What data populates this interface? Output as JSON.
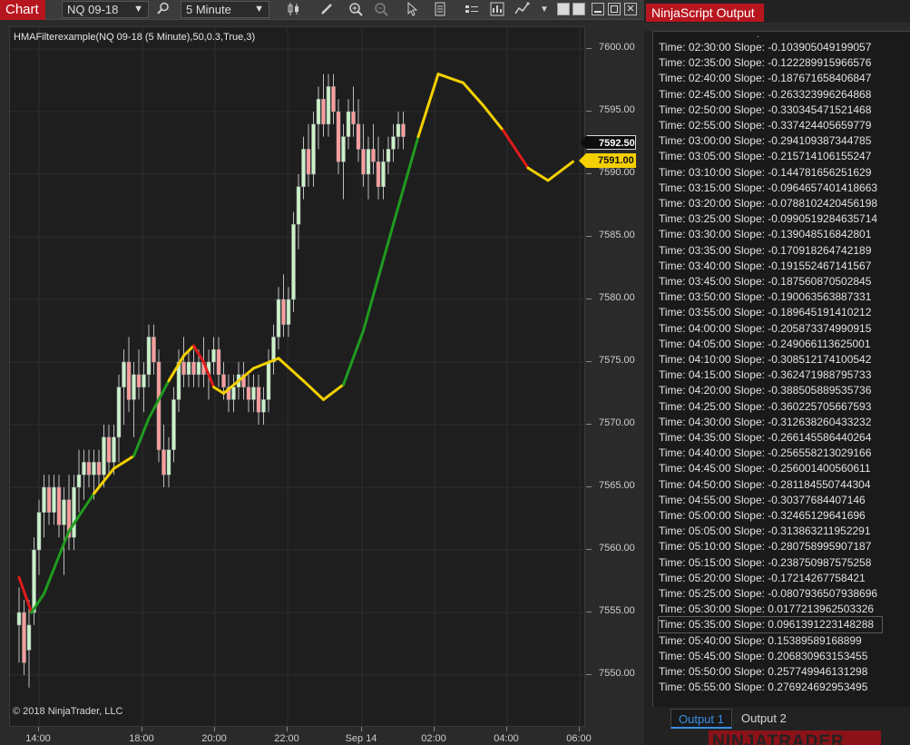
{
  "chart_toolbar": {
    "tab_label": "Chart",
    "instrument": "NQ 09-18",
    "interval": "5 Minute"
  },
  "chart": {
    "indicator_label": "HMAFilterexample(NQ 09-18 (5 Minute),50,0.3,True,3)",
    "copyright": "© 2018 NinjaTrader, LLC",
    "last_price": "7592.50",
    "indicator_value": "7591.00",
    "price_labels": [
      "7600.00",
      "7595.00",
      "7590.00",
      "7585.00",
      "7580.00",
      "7575.00",
      "7570.00",
      "7565.00",
      "7560.00",
      "7555.00",
      "7550.00"
    ],
    "time_labels": [
      "14:00",
      "18:00",
      "20:00",
      "22:00",
      "Sep 14",
      "02:00",
      "04:00",
      "06:00"
    ]
  },
  "colors": {
    "rising": "#1f9b1f",
    "falling": "#e01b1b",
    "flat": "#f2d000",
    "candle_up": "#c9f2c9",
    "candle_down": "#ff9c9c",
    "accent": "#b7161f"
  },
  "chart_data": {
    "type": "candlestick",
    "ylim": [
      7548,
      7603
    ],
    "x_labels": [
      "14:00",
      "18:00",
      "20:00",
      "22:00",
      "Sep 14",
      "02:00",
      "04:00",
      "06:00"
    ],
    "hma_series": [
      {
        "x": 0,
        "y": 7557.8,
        "c": "falling"
      },
      {
        "x": 5,
        "y": 7555.0,
        "c": "falling"
      },
      {
        "x": 10,
        "y": 7556.5,
        "c": "rising"
      },
      {
        "x": 20,
        "y": 7561.5,
        "c": "rising"
      },
      {
        "x": 30,
        "y": 7564.5,
        "c": "rising"
      },
      {
        "x": 38,
        "y": 7566.5,
        "c": "flat"
      },
      {
        "x": 46,
        "y": 7567.5,
        "c": "flat"
      },
      {
        "x": 52,
        "y": 7570.5,
        "c": "rising"
      },
      {
        "x": 60,
        "y": 7573.5,
        "c": "rising"
      },
      {
        "x": 66,
        "y": 7575.5,
        "c": "flat"
      },
      {
        "x": 70,
        "y": 7576.3,
        "c": "flat"
      },
      {
        "x": 74,
        "y": 7575.0,
        "c": "falling"
      },
      {
        "x": 78,
        "y": 7573.0,
        "c": "falling"
      },
      {
        "x": 82,
        "y": 7572.5,
        "c": "flat"
      },
      {
        "x": 94,
        "y": 7574.5,
        "c": "flat"
      },
      {
        "x": 104,
        "y": 7575.3,
        "c": "flat"
      },
      {
        "x": 114,
        "y": 7573.5,
        "c": "flat"
      },
      {
        "x": 122,
        "y": 7572.0,
        "c": "flat"
      },
      {
        "x": 130,
        "y": 7573.2,
        "c": "flat"
      },
      {
        "x": 138,
        "y": 7577.5,
        "c": "rising"
      },
      {
        "x": 150,
        "y": 7586.0,
        "c": "rising"
      },
      {
        "x": 160,
        "y": 7593.0,
        "c": "rising"
      },
      {
        "x": 168,
        "y": 7598.0,
        "c": "flat"
      },
      {
        "x": 178,
        "y": 7597.3,
        "c": "flat"
      },
      {
        "x": 186,
        "y": 7595.5,
        "c": "flat"
      },
      {
        "x": 194,
        "y": 7593.5,
        "c": "flat"
      },
      {
        "x": 204,
        "y": 7590.5,
        "c": "falling"
      },
      {
        "x": 212,
        "y": 7589.5,
        "c": "flat"
      },
      {
        "x": 222,
        "y": 7591.0,
        "c": "flat"
      }
    ],
    "candles": [
      {
        "x": 0,
        "o": 7554,
        "h": 7557,
        "l": 7551,
        "c": 7555
      },
      {
        "x": 2,
        "o": 7555,
        "h": 7556,
        "l": 7550,
        "c": 7551
      },
      {
        "x": 4,
        "o": 7552,
        "h": 7556,
        "l": 7549,
        "c": 7554
      },
      {
        "x": 6,
        "o": 7555,
        "h": 7561,
        "l": 7554,
        "c": 7560
      },
      {
        "x": 8,
        "o": 7560,
        "h": 7564,
        "l": 7558,
        "c": 7563
      },
      {
        "x": 10,
        "o": 7563,
        "h": 7566,
        "l": 7561,
        "c": 7565
      },
      {
        "x": 12,
        "o": 7565,
        "h": 7566,
        "l": 7562,
        "c": 7563
      },
      {
        "x": 14,
        "o": 7563,
        "h": 7566,
        "l": 7562,
        "c": 7565
      },
      {
        "x": 16,
        "o": 7565,
        "h": 7566,
        "l": 7561,
        "c": 7562
      },
      {
        "x": 18,
        "o": 7562,
        "h": 7565,
        "l": 7558,
        "c": 7564
      },
      {
        "x": 20,
        "o": 7564,
        "h": 7566,
        "l": 7560,
        "c": 7561
      },
      {
        "x": 22,
        "o": 7561,
        "h": 7566,
        "l": 7560,
        "c": 7565
      },
      {
        "x": 24,
        "o": 7565,
        "h": 7568,
        "l": 7563,
        "c": 7566
      },
      {
        "x": 26,
        "o": 7566,
        "h": 7568,
        "l": 7564,
        "c": 7567
      },
      {
        "x": 28,
        "o": 7567,
        "h": 7568,
        "l": 7565,
        "c": 7566
      },
      {
        "x": 30,
        "o": 7566,
        "h": 7568,
        "l": 7564,
        "c": 7567
      },
      {
        "x": 32,
        "o": 7567,
        "h": 7568,
        "l": 7565,
        "c": 7566
      },
      {
        "x": 34,
        "o": 7566,
        "h": 7570,
        "l": 7565,
        "c": 7569
      },
      {
        "x": 36,
        "o": 7569,
        "h": 7570,
        "l": 7566,
        "c": 7567
      },
      {
        "x": 38,
        "o": 7567,
        "h": 7570,
        "l": 7566,
        "c": 7569
      },
      {
        "x": 40,
        "o": 7569,
        "h": 7574,
        "l": 7567,
        "c": 7573
      },
      {
        "x": 42,
        "o": 7573,
        "h": 7576,
        "l": 7570,
        "c": 7575
      },
      {
        "x": 44,
        "o": 7575,
        "h": 7577,
        "l": 7571,
        "c": 7572
      },
      {
        "x": 46,
        "o": 7572,
        "h": 7575,
        "l": 7569,
        "c": 7574
      },
      {
        "x": 48,
        "o": 7574,
        "h": 7576,
        "l": 7572,
        "c": 7573
      },
      {
        "x": 50,
        "o": 7573,
        "h": 7575,
        "l": 7571,
        "c": 7574
      },
      {
        "x": 52,
        "o": 7574,
        "h": 7578,
        "l": 7573,
        "c": 7577
      },
      {
        "x": 54,
        "o": 7577,
        "h": 7578,
        "l": 7574,
        "c": 7575
      },
      {
        "x": 56,
        "o": 7575,
        "h": 7576,
        "l": 7567,
        "c": 7568
      },
      {
        "x": 58,
        "o": 7568,
        "h": 7570,
        "l": 7565,
        "c": 7566
      },
      {
        "x": 60,
        "o": 7566,
        "h": 7569,
        "l": 7565,
        "c": 7568
      },
      {
        "x": 62,
        "o": 7568,
        "h": 7573,
        "l": 7567,
        "c": 7572
      },
      {
        "x": 64,
        "o": 7572,
        "h": 7576,
        "l": 7571,
        "c": 7575
      },
      {
        "x": 66,
        "o": 7575,
        "h": 7577,
        "l": 7573,
        "c": 7574
      },
      {
        "x": 68,
        "o": 7574,
        "h": 7576,
        "l": 7573,
        "c": 7575
      },
      {
        "x": 70,
        "o": 7575,
        "h": 7576,
        "l": 7573,
        "c": 7574
      },
      {
        "x": 72,
        "o": 7574,
        "h": 7576,
        "l": 7573,
        "c": 7575
      },
      {
        "x": 74,
        "o": 7575,
        "h": 7577,
        "l": 7573,
        "c": 7574
      },
      {
        "x": 76,
        "o": 7574,
        "h": 7576,
        "l": 7572,
        "c": 7575
      },
      {
        "x": 78,
        "o": 7575,
        "h": 7577,
        "l": 7574,
        "c": 7576
      },
      {
        "x": 80,
        "o": 7576,
        "h": 7577,
        "l": 7573,
        "c": 7574
      },
      {
        "x": 82,
        "o": 7574,
        "h": 7575,
        "l": 7572,
        "c": 7573
      },
      {
        "x": 84,
        "o": 7573,
        "h": 7574,
        "l": 7571,
        "c": 7572
      },
      {
        "x": 86,
        "o": 7572,
        "h": 7574,
        "l": 7571,
        "c": 7573
      },
      {
        "x": 88,
        "o": 7573,
        "h": 7575,
        "l": 7572,
        "c": 7574
      },
      {
        "x": 90,
        "o": 7574,
        "h": 7575,
        "l": 7572,
        "c": 7573
      },
      {
        "x": 92,
        "o": 7573,
        "h": 7574,
        "l": 7571,
        "c": 7572
      },
      {
        "x": 94,
        "o": 7572,
        "h": 7574,
        "l": 7571,
        "c": 7573
      },
      {
        "x": 96,
        "o": 7573,
        "h": 7574,
        "l": 7570,
        "c": 7571
      },
      {
        "x": 98,
        "o": 7571,
        "h": 7573,
        "l": 7570,
        "c": 7572
      },
      {
        "x": 100,
        "o": 7572,
        "h": 7576,
        "l": 7571,
        "c": 7575
      },
      {
        "x": 102,
        "o": 7575,
        "h": 7578,
        "l": 7574,
        "c": 7577
      },
      {
        "x": 104,
        "o": 7577,
        "h": 7581,
        "l": 7576,
        "c": 7580
      },
      {
        "x": 106,
        "o": 7580,
        "h": 7582,
        "l": 7577,
        "c": 7578
      },
      {
        "x": 108,
        "o": 7578,
        "h": 7581,
        "l": 7577,
        "c": 7580
      },
      {
        "x": 110,
        "o": 7580,
        "h": 7587,
        "l": 7579,
        "c": 7586
      },
      {
        "x": 112,
        "o": 7586,
        "h": 7590,
        "l": 7584,
        "c": 7589
      },
      {
        "x": 114,
        "o": 7589,
        "h": 7593,
        "l": 7588,
        "c": 7592
      },
      {
        "x": 116,
        "o": 7592,
        "h": 7594,
        "l": 7589,
        "c": 7590
      },
      {
        "x": 118,
        "o": 7590,
        "h": 7595,
        "l": 7589,
        "c": 7594
      },
      {
        "x": 120,
        "o": 7594,
        "h": 7597,
        "l": 7592,
        "c": 7596
      },
      {
        "x": 122,
        "o": 7596,
        "h": 7598,
        "l": 7593,
        "c": 7594
      },
      {
        "x": 124,
        "o": 7594,
        "h": 7598,
        "l": 7593,
        "c": 7597
      },
      {
        "x": 126,
        "o": 7597,
        "h": 7598,
        "l": 7594,
        "c": 7595
      },
      {
        "x": 128,
        "o": 7595,
        "h": 7596,
        "l": 7590,
        "c": 7591
      },
      {
        "x": 130,
        "o": 7591,
        "h": 7594,
        "l": 7588,
        "c": 7593
      },
      {
        "x": 132,
        "o": 7593,
        "h": 7596,
        "l": 7592,
        "c": 7595
      },
      {
        "x": 134,
        "o": 7595,
        "h": 7597,
        "l": 7593,
        "c": 7594
      },
      {
        "x": 136,
        "o": 7594,
        "h": 7596,
        "l": 7591,
        "c": 7592
      },
      {
        "x": 138,
        "o": 7592,
        "h": 7594,
        "l": 7589,
        "c": 7590
      },
      {
        "x": 140,
        "o": 7590,
        "h": 7593,
        "l": 7588,
        "c": 7592
      },
      {
        "x": 142,
        "o": 7592,
        "h": 7594,
        "l": 7590,
        "c": 7591
      },
      {
        "x": 144,
        "o": 7591,
        "h": 7593,
        "l": 7588,
        "c": 7589
      },
      {
        "x": 146,
        "o": 7589,
        "h": 7592,
        "l": 7588,
        "c": 7591
      },
      {
        "x": 148,
        "o": 7591,
        "h": 7593,
        "l": 7590,
        "c": 7592
      },
      {
        "x": 150,
        "o": 7592,
        "h": 7594,
        "l": 7591,
        "c": 7593
      },
      {
        "x": 152,
        "o": 7593,
        "h": 7595,
        "l": 7592,
        "c": 7594
      },
      {
        "x": 154,
        "o": 7594,
        "h": 7595,
        "l": 7592,
        "c": 7593
      }
    ]
  },
  "output": {
    "title": "NinjaScript Output",
    "lines": [
      "Time: 02:30:00  Slope: -0.103905049199057",
      "Time: 02:35:00  Slope: -0.122289915966576",
      "Time: 02:40:00  Slope: -0.187671658406847",
      "Time: 02:45:00  Slope: -0.263323996264868",
      "Time: 02:50:00  Slope: -0.330345471521468",
      "Time: 02:55:00  Slope: -0.337424405659779",
      "Time: 03:00:00  Slope: -0.294109387344785",
      "Time: 03:05:00  Slope: -0.215714106155247",
      "Time: 03:10:00  Slope: -0.144781656251629",
      "Time: 03:15:00  Slope: -0.0964657401418663",
      "Time: 03:20:00  Slope: -0.0788102420456198",
      "Time: 03:25:00  Slope: -0.0990519284635714",
      "Time: 03:30:00  Slope: -0.139048516842801",
      "Time: 03:35:00  Slope: -0.170918264742189",
      "Time: 03:40:00  Slope: -0.191552467141567",
      "Time: 03:45:00  Slope: -0.187560870502845",
      "Time: 03:50:00  Slope: -0.190063563887331",
      "Time: 03:55:00  Slope: -0.189645191410212",
      "Time: 04:00:00  Slope: -0.205873374990915",
      "Time: 04:05:00  Slope: -0.249066113625001",
      "Time: 04:10:00  Slope: -0.308512174100542",
      "Time: 04:15:00  Slope: -0.362471988795733",
      "Time: 04:20:00  Slope: -0.388505889535736",
      "Time: 04:25:00  Slope: -0.360225705667593",
      "Time: 04:30:00  Slope: -0.312638260433232",
      "Time: 04:35:00  Slope: -0.266145586440264",
      "Time: 04:40:00  Slope: -0.256558213029166",
      "Time: 04:45:00  Slope: -0.256001400560611",
      "Time: 04:50:00  Slope: -0.281184550744304",
      "Time: 04:55:00  Slope: -0.30377684407146",
      "Time: 05:00:00  Slope: -0.32465129641696",
      "Time: 05:05:00  Slope: -0.313863211952291",
      "Time: 05:10:00  Slope: -0.280758995907187",
      "Time: 05:15:00  Slope: -0.238750987575258",
      "Time: 05:20:00  Slope: -0.17214267758421",
      "Time: 05:25:00  Slope: -0.0807936507938696",
      "Time: 05:30:00  Slope: 0.0177213962503326",
      "Time: 05:35:00  Slope: 0.0961391223148288",
      "Time: 05:40:00  Slope: 0.15389589168899",
      "Time: 05:45:00  Slope: 0.206830963153455",
      "Time: 05:50:00  Slope: 0.257749946131298",
      "Time: 05:55:00  Slope: 0.276924692953495"
    ],
    "highlight_index": 37,
    "tab_active": "Output 1",
    "tab_inactive": "Output 2",
    "brand": "NINJATRADER"
  }
}
